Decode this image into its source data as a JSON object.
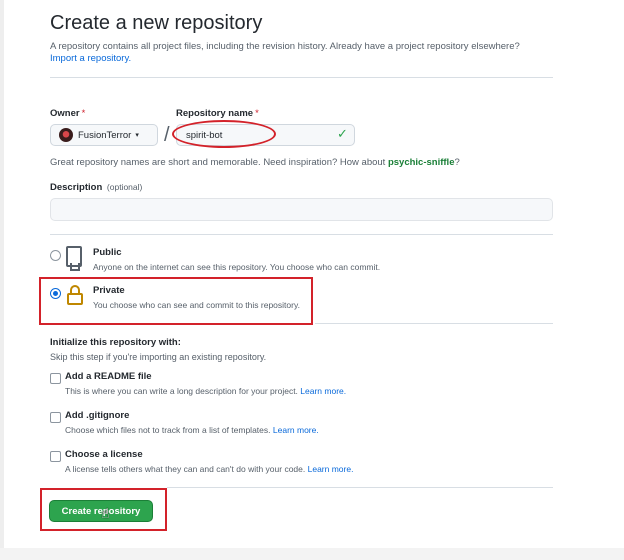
{
  "header": {
    "title": "Create a new repository",
    "subtitle": "A repository contains all project files, including the revision history. Already have a project repository elsewhere?",
    "import_link": "Import a repository."
  },
  "owner": {
    "label": "Owner",
    "required_mark": "*",
    "value": "FusionTerror",
    "caret": "▾"
  },
  "separator": "/",
  "repo_name": {
    "label": "Repository name",
    "required_mark": "*",
    "value": "spirit-bot",
    "valid_icon": "✓"
  },
  "name_hint": {
    "text": "Great repository names are short and memorable. Need inspiration? How about",
    "suggestion": "psychic-sniffle",
    "end": "?"
  },
  "description": {
    "label": "Description",
    "optional": "(optional)",
    "value": ""
  },
  "visibility": {
    "selected": "private",
    "public": {
      "title": "Public",
      "desc": "Anyone on the internet can see this repository. You choose who can commit.",
      "icon": "repo-icon"
    },
    "private": {
      "title": "Private",
      "desc": "You choose who can see and commit to this repository.",
      "icon": "lock-icon"
    }
  },
  "initialize": {
    "title": "Initialize this repository with:",
    "desc": "Skip this step if you're importing an existing repository.",
    "options": [
      {
        "label": "Add a README file",
        "desc": "This is where you can write a long description for your project.",
        "link": "Learn more.",
        "checked": false
      },
      {
        "label": "Add .gitignore",
        "desc": "Choose which files not to track from a list of templates.",
        "link": "Learn more.",
        "checked": false
      },
      {
        "label": "Choose a license",
        "desc": "A license tells others what they can and can't do with your code.",
        "link": "Learn more.",
        "checked": false
      }
    ]
  },
  "create_button": {
    "label": "Create repository"
  },
  "colors": {
    "accent_link": "#0969da",
    "primary_button": "#2da44e",
    "annotation_red": "#d3222a",
    "lock_gold": "#bf8700"
  }
}
